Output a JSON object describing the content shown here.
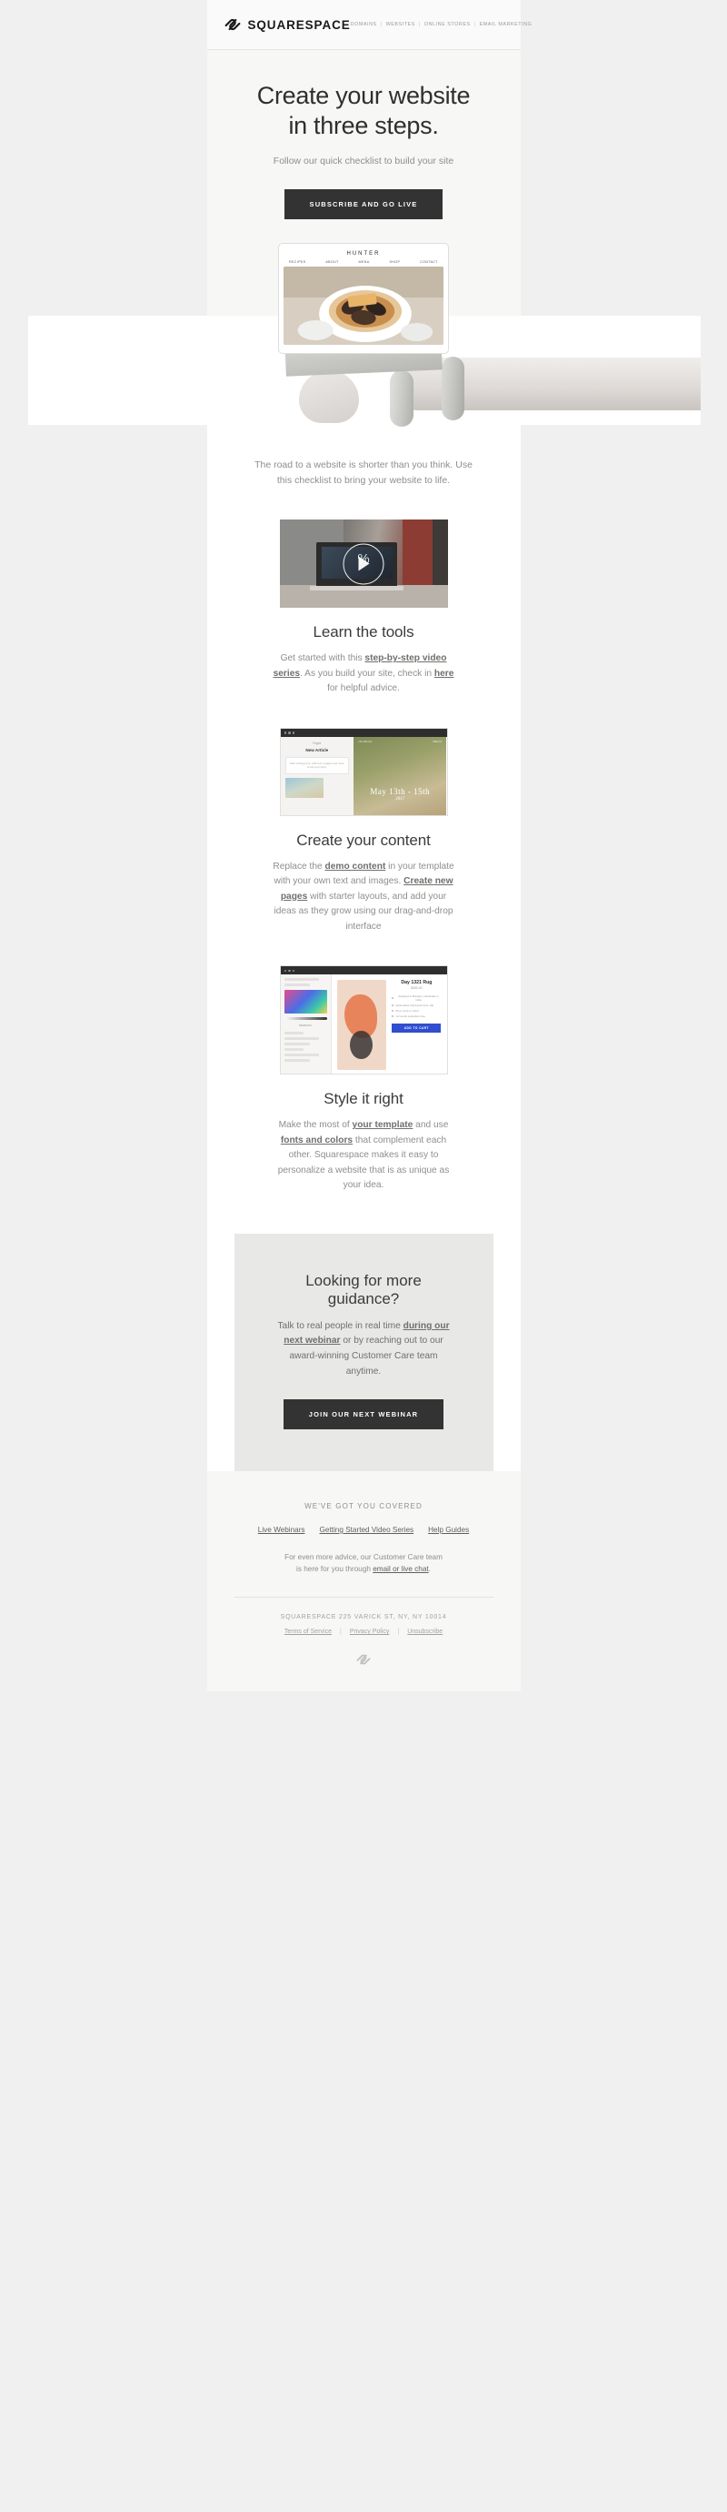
{
  "header": {
    "brand_name": "SQUARESPACE",
    "nav": [
      "DOMAINS",
      "WEBSITES",
      "ONLINE STORES",
      "EMAIL MARKETING"
    ],
    "nav_separator": "|"
  },
  "hero": {
    "heading_line1": "Create your website",
    "heading_line2": "in three steps.",
    "subheading": "Follow our quick checklist to build your site",
    "cta_label": "SUBSCRIBE AND GO LIVE",
    "device": {
      "site_name": "HUNTER",
      "nav": [
        "RECIPES",
        "ABOUT",
        "MENU",
        "SHOP",
        "CONTACT"
      ]
    }
  },
  "intro": {
    "copy": "The road to a website is shorter than you think. Use this checklist to bring your website to life."
  },
  "steps": [
    {
      "title": "Learn the tools",
      "body_1": "Get started with this ",
      "link_1": "step-by-step video series",
      "body_2": ". As you build your site, check in ",
      "link_2": "here",
      "body_3": " for helpful advice.",
      "video_percent": "%"
    },
    {
      "title": "Create your content",
      "body_1": "Replace the ",
      "link_1": "demo content",
      "body_2": " in your template with your own text and images. ",
      "link_2": "Create new pages",
      "body_3": " with starter layouts, and add your ideas as they grow using our drag-and-drop interface",
      "builder": {
        "sidebar_label": "Pages",
        "sidebar_title": "New Article",
        "card_text": "Start writing here. Add text, images and more to tell your story.",
        "overlay_nav": [
          "JOURNAL",
          "MENU"
        ],
        "date_line1": "May 13th - 15th",
        "date_line2": "2017"
      }
    },
    {
      "title": "Style it right",
      "body_1": "Make the most of ",
      "link_1": "your template",
      "body_2": " and use ",
      "link_2": "fonts and colors",
      "body_3": " that complement each other. Squarespace makes it easy to personalize a website that is as unique as your idea.",
      "styler": {
        "hex_value": "#E8845C",
        "product_name": "Day 1321 Rug",
        "product_price": "$450.00",
        "bullets": [
          "Designed in Brooklyn, handmade in India",
          "Hand-tufted, hand-dyed wool, silk",
          "80 gr. wool on cotton",
          "1-2 month production time"
        ],
        "add_to_cart": "ADD TO CART"
      }
    }
  ],
  "guidance": {
    "title": "Looking for more guidance?",
    "body_1": "Talk to real people in real time ",
    "link_1": "during our next webinar",
    "body_2": " or by reaching out to our award-winning Customer Care team anytime.",
    "cta_label": "JOIN OUR NEXT WEBINAR"
  },
  "footer": {
    "heading": "WE'VE GOT YOU COVERED",
    "links": [
      "Live Webinars",
      "Getting Started Video Series",
      "Help Guides"
    ],
    "note_1": "For even more advice, our Customer Care team",
    "note_2": "is here for you through ",
    "note_link": "email or live chat",
    "note_3": ".",
    "address": "SQUARESPACE 225 VARICK ST, NY, NY 10014",
    "legal_links": [
      "Terms of Service",
      "Privacy Policy",
      "Unsubscribe"
    ],
    "legal_separator": "|"
  },
  "colors": {
    "page_bg": "#f0f0f0",
    "email_bg": "#f7f7f6",
    "button_bg": "#333333",
    "guidance_bg": "#e8e8e7",
    "text_dark": "#2f2f2f",
    "text_muted": "#8e8e8c"
  }
}
